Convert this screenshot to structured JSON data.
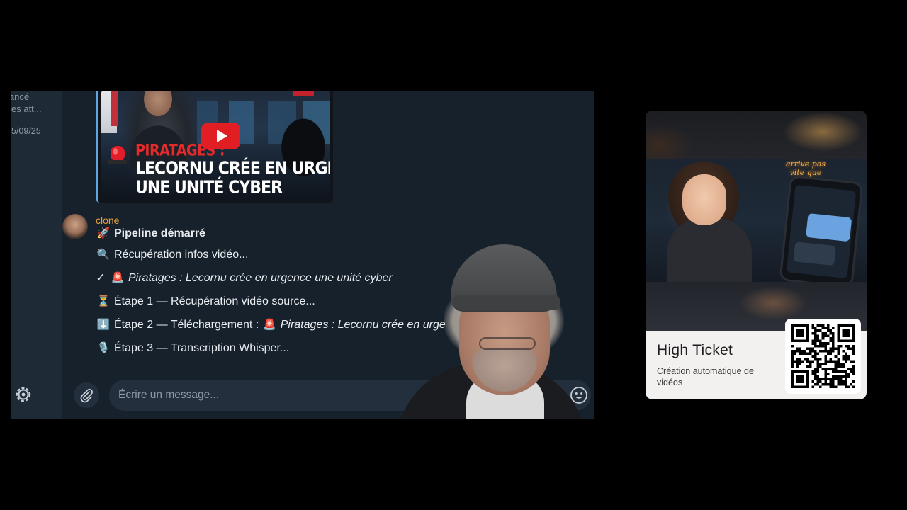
{
  "sidebar": {
    "chat_preview_text": "lancé\nes att...",
    "chat_preview_date": "5/09/25"
  },
  "video": {
    "title_line1": "PIRATAGES :",
    "title_line2": "LECORNU CRÉE EN URGENCE",
    "title_line3": "UNE UNITÉ CYBER"
  },
  "message": {
    "author": "clone",
    "header_icon": "🚀",
    "header": "Pipeline démarré",
    "lines": [
      {
        "icon": "🔍",
        "text": "Récupération infos vidéo...",
        "italic": ""
      },
      {
        "icon": "✓",
        "sub_icon": "🚨",
        "text": "",
        "italic": "Piratages : Lecornu crée en urgence une unité cyber"
      },
      {
        "icon": "⏳",
        "text": "Étape 1 — Récupération vidéo source...",
        "italic": ""
      },
      {
        "icon": "⬇️",
        "text": "Étape 2 — Téléchargement : ",
        "sub_icon": "🚨",
        "italic": "Piratages : Lecornu crée en urge"
      },
      {
        "icon": "🎙️",
        "text": "Étape 3 — Transcription Whisper...",
        "italic": ""
      }
    ]
  },
  "composer": {
    "placeholder": "Écrire un message..."
  },
  "promo": {
    "neon_text": "arrive pas vite que prévu",
    "title": "High Ticket",
    "subtitle": "Création automatique de vidéos"
  },
  "colors": {
    "author": "#e8a23b",
    "accent": "#5fa6e0",
    "youtube": "#e01e24"
  }
}
